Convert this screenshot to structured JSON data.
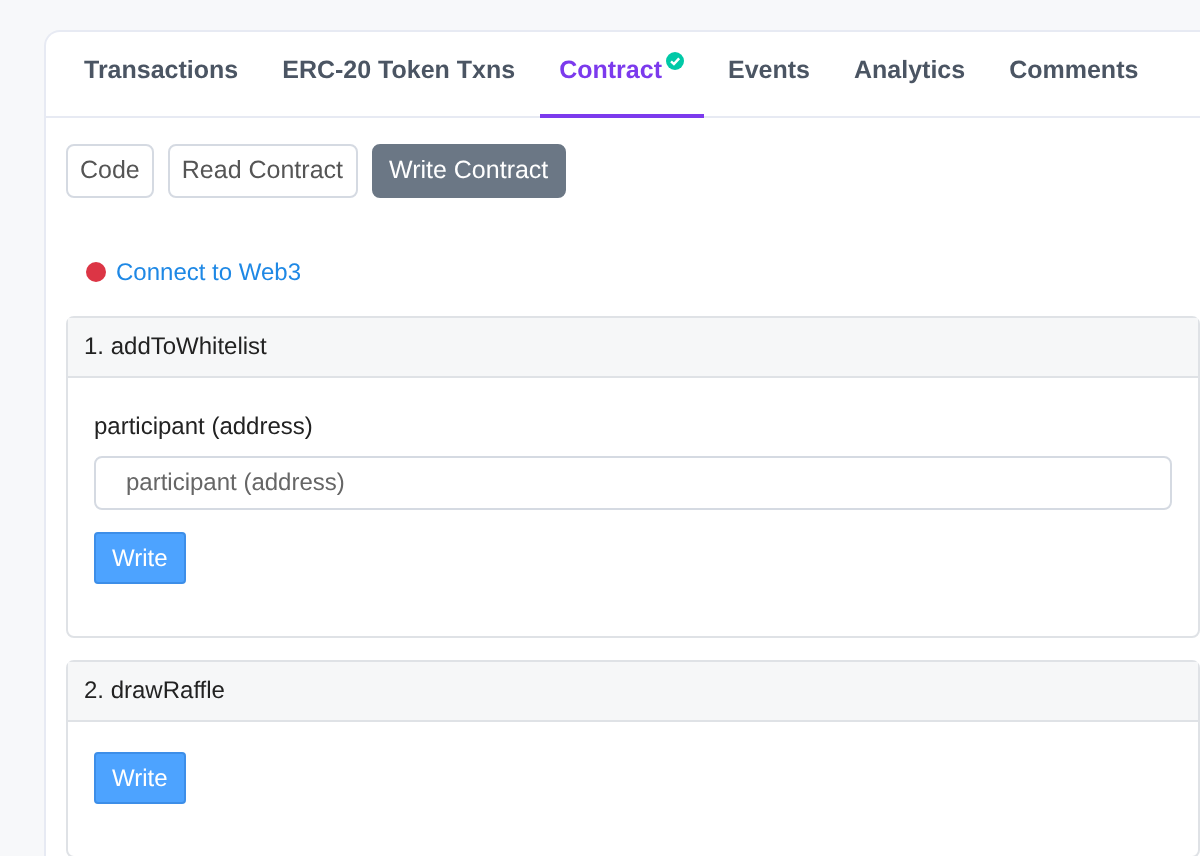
{
  "tabs": [
    {
      "label": "Transactions",
      "selected": false,
      "verified": false
    },
    {
      "label": "ERC-20 Token Txns",
      "selected": false,
      "verified": false
    },
    {
      "label": "Contract",
      "selected": true,
      "verified": true
    },
    {
      "label": "Events",
      "selected": false,
      "verified": false
    },
    {
      "label": "Analytics",
      "selected": false,
      "verified": false
    },
    {
      "label": "Comments",
      "selected": false,
      "verified": false
    }
  ],
  "subtabs": [
    {
      "label": "Code",
      "selected": false
    },
    {
      "label": "Read Contract",
      "selected": false
    },
    {
      "label": "Write Contract",
      "selected": true
    }
  ],
  "connect": {
    "label": "Connect to Web3",
    "color": "#dc3545"
  },
  "functions": [
    {
      "title": "1. addToWhitelist",
      "inputs": [
        {
          "label": "participant (address)",
          "placeholder": "participant (address)"
        }
      ],
      "button": "Write"
    },
    {
      "title": "2. drawRaffle",
      "button": "Write"
    }
  ]
}
